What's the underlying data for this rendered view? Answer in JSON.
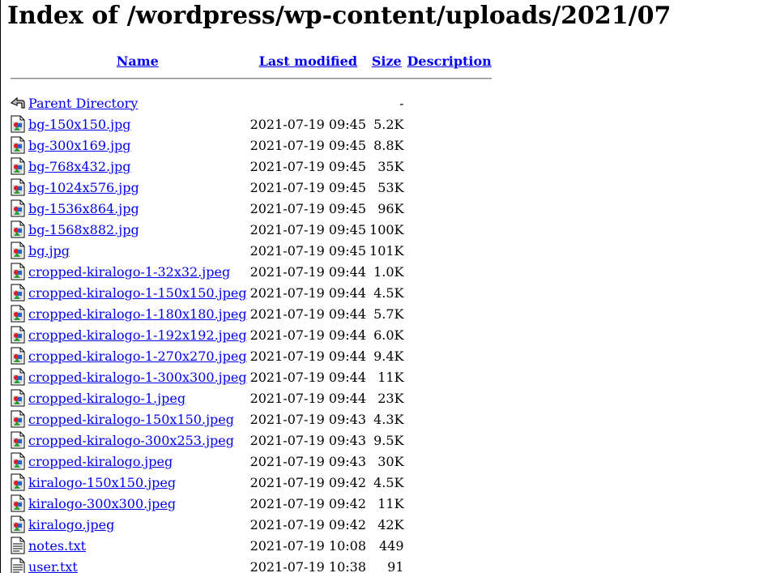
{
  "page": {
    "title": "Index of /wordpress/wp-content/uploads/2021/07"
  },
  "columns": {
    "name": "Name",
    "last_modified": "Last modified",
    "size": "Size",
    "description": "Description"
  },
  "parent": {
    "label": "Parent Directory",
    "size": "-",
    "icon": "back-arrow-icon"
  },
  "files": [
    {
      "name": "bg-150x150.jpg",
      "modified": "2021-07-19 09:45",
      "size": "5.2K",
      "icon": "image-file-icon"
    },
    {
      "name": "bg-300x169.jpg",
      "modified": "2021-07-19 09:45",
      "size": "8.8K",
      "icon": "image-file-icon"
    },
    {
      "name": "bg-768x432.jpg",
      "modified": "2021-07-19 09:45",
      "size": "35K",
      "icon": "image-file-icon"
    },
    {
      "name": "bg-1024x576.jpg",
      "modified": "2021-07-19 09:45",
      "size": "53K",
      "icon": "image-file-icon"
    },
    {
      "name": "bg-1536x864.jpg",
      "modified": "2021-07-19 09:45",
      "size": "96K",
      "icon": "image-file-icon"
    },
    {
      "name": "bg-1568x882.jpg",
      "modified": "2021-07-19 09:45",
      "size": "100K",
      "icon": "image-file-icon"
    },
    {
      "name": "bg.jpg",
      "modified": "2021-07-19 09:45",
      "size": "101K",
      "icon": "image-file-icon"
    },
    {
      "name": "cropped-kiralogo-1-32x32.jpeg",
      "modified": "2021-07-19 09:44",
      "size": "1.0K",
      "icon": "image-file-icon"
    },
    {
      "name": "cropped-kiralogo-1-150x150.jpeg",
      "modified": "2021-07-19 09:44",
      "size": "4.5K",
      "icon": "image-file-icon"
    },
    {
      "name": "cropped-kiralogo-1-180x180.jpeg",
      "modified": "2021-07-19 09:44",
      "size": "5.7K",
      "icon": "image-file-icon"
    },
    {
      "name": "cropped-kiralogo-1-192x192.jpeg",
      "modified": "2021-07-19 09:44",
      "size": "6.0K",
      "icon": "image-file-icon"
    },
    {
      "name": "cropped-kiralogo-1-270x270.jpeg",
      "modified": "2021-07-19 09:44",
      "size": "9.4K",
      "icon": "image-file-icon"
    },
    {
      "name": "cropped-kiralogo-1-300x300.jpeg",
      "modified": "2021-07-19 09:44",
      "size": "11K",
      "icon": "image-file-icon"
    },
    {
      "name": "cropped-kiralogo-1.jpeg",
      "modified": "2021-07-19 09:44",
      "size": "23K",
      "icon": "image-file-icon"
    },
    {
      "name": "cropped-kiralogo-150x150.jpeg",
      "modified": "2021-07-19 09:43",
      "size": "4.3K",
      "icon": "image-file-icon"
    },
    {
      "name": "cropped-kiralogo-300x253.jpeg",
      "modified": "2021-07-19 09:43",
      "size": "9.5K",
      "icon": "image-file-icon"
    },
    {
      "name": "cropped-kiralogo.jpeg",
      "modified": "2021-07-19 09:43",
      "size": "30K",
      "icon": "image-file-icon"
    },
    {
      "name": "kiralogo-150x150.jpeg",
      "modified": "2021-07-19 09:42",
      "size": "4.5K",
      "icon": "image-file-icon"
    },
    {
      "name": "kiralogo-300x300.jpeg",
      "modified": "2021-07-19 09:42",
      "size": "11K",
      "icon": "image-file-icon"
    },
    {
      "name": "kiralogo.jpeg",
      "modified": "2021-07-19 09:42",
      "size": "42K",
      "icon": "image-file-icon"
    },
    {
      "name": "notes.txt",
      "modified": "2021-07-19 10:08",
      "size": "449",
      "icon": "text-file-icon"
    },
    {
      "name": "user.txt",
      "modified": "2021-07-19 10:38",
      "size": "91",
      "icon": "text-file-icon"
    }
  ],
  "colors": {
    "link": "#0000ee",
    "text": "#000000",
    "background": "#ffffff"
  }
}
